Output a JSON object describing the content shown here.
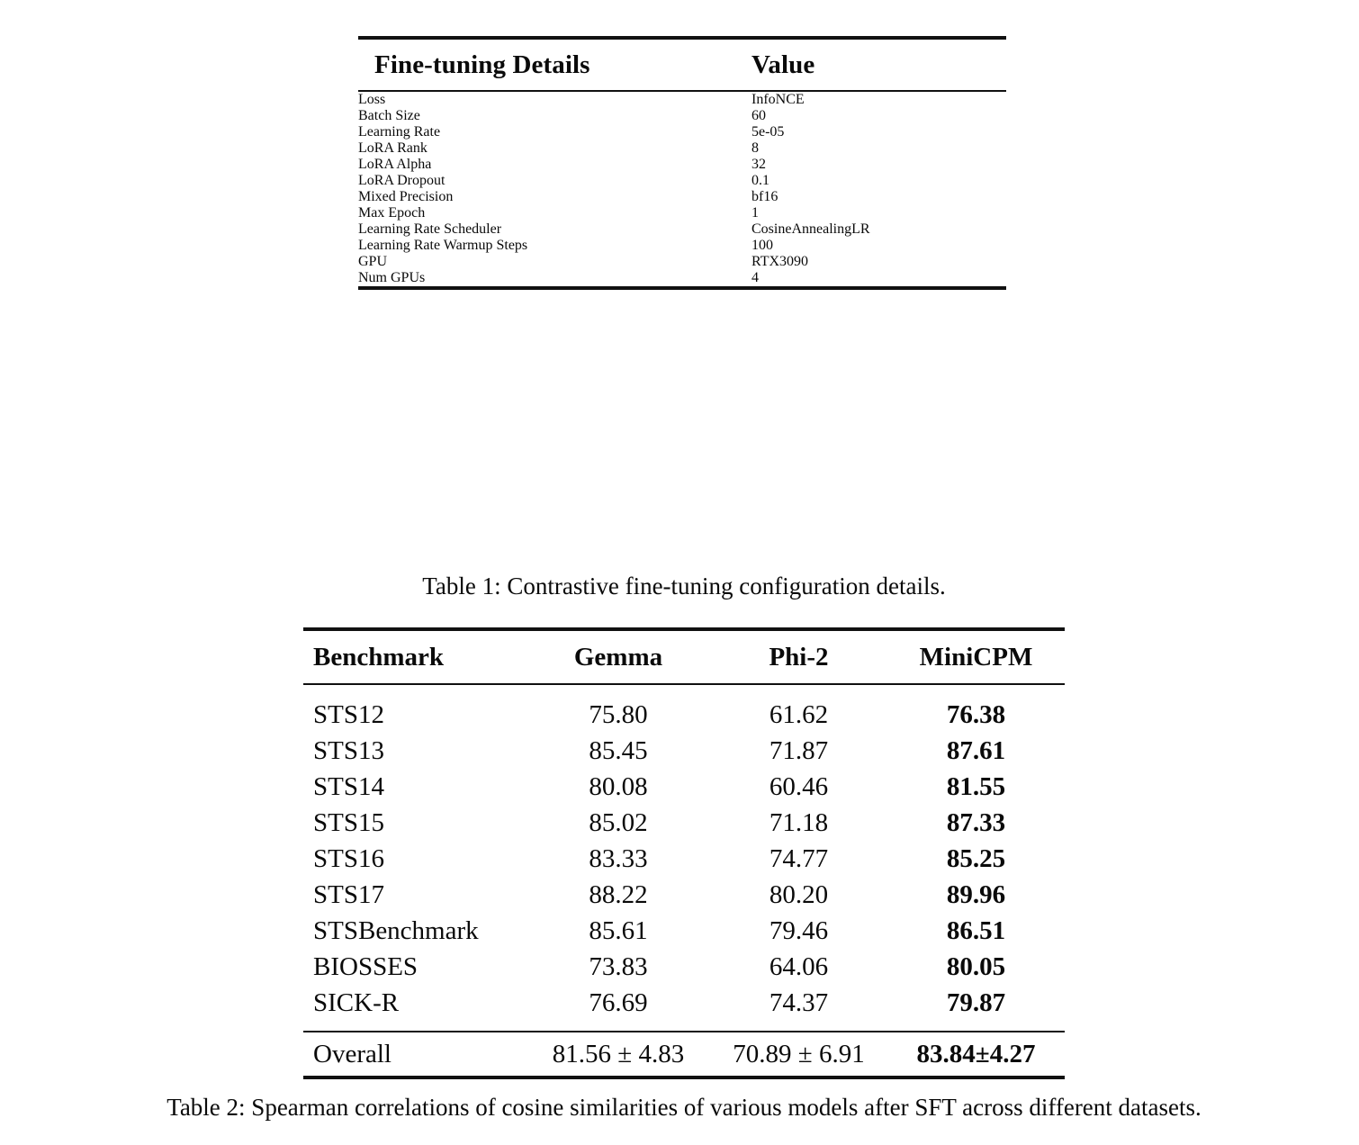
{
  "table1": {
    "headers": [
      "Fine-tuning Details",
      "Value"
    ],
    "rows": [
      [
        "Loss",
        "InfoNCE"
      ],
      [
        "Batch Size",
        "60"
      ],
      [
        "Learning Rate",
        "5e-05"
      ],
      [
        "LoRA Rank",
        "8"
      ],
      [
        "LoRA Alpha",
        "32"
      ],
      [
        "LoRA Dropout",
        "0.1"
      ],
      [
        "Mixed Precision",
        "bf16"
      ],
      [
        "Max Epoch",
        "1"
      ],
      [
        "Learning Rate Scheduler",
        "CosineAnnealingLR"
      ],
      [
        "Learning Rate Warmup Steps",
        "100"
      ],
      [
        "GPU",
        "RTX3090"
      ],
      [
        "Num GPUs",
        "4"
      ]
    ],
    "caption": "Table 1: Contrastive fine-tuning configuration details."
  },
  "table2": {
    "headers": [
      "Benchmark",
      "Gemma",
      "Phi-2",
      "MiniCPM"
    ],
    "rows": [
      [
        "STS12",
        "75.80",
        "61.62",
        "76.38"
      ],
      [
        "STS13",
        "85.45",
        "71.87",
        "87.61"
      ],
      [
        "STS14",
        "80.08",
        "60.46",
        "81.55"
      ],
      [
        "STS15",
        "85.02",
        "71.18",
        "87.33"
      ],
      [
        "STS16",
        "83.33",
        "74.77",
        "85.25"
      ],
      [
        "STS17",
        "88.22",
        "80.20",
        "89.96"
      ],
      [
        "STSBenchmark",
        "85.61",
        "79.46",
        "86.51"
      ],
      [
        "BIOSSES",
        "73.83",
        "64.06",
        "80.05"
      ],
      [
        "SICK-R",
        "76.69",
        "74.37",
        "79.87"
      ]
    ],
    "total_row": [
      "Overall",
      "81.56 ± 4.83",
      "70.89 ± 6.91",
      "83.84±4.27"
    ],
    "caption": "Table 2:  Spearman correlations of cosine similarities of various models after SFT across different datasets."
  }
}
